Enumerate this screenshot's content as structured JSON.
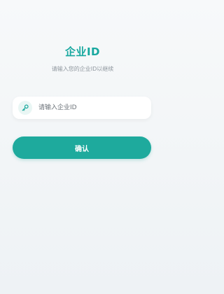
{
  "header": {
    "title": "企业ID",
    "subtitle": "请输入您的企业ID以继续"
  },
  "form": {
    "enterprise_id": {
      "value": "",
      "placeholder": "请输入企业ID",
      "icon": "key-icon"
    },
    "confirm_label": "确认"
  },
  "colors": {
    "accent": "#17a89f",
    "button": "#1eaa9d",
    "icon_bg": "#e9f6f4",
    "subtitle": "#8f979e",
    "background": "#f4f7f9"
  }
}
